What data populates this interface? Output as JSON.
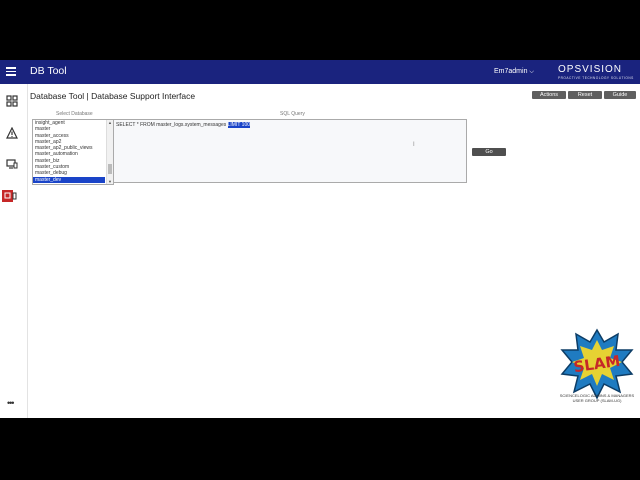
{
  "header": {
    "app_title": "DB Tool",
    "user": "Em7admin",
    "logo_main": "OPSVISION",
    "logo_sub": "PROACTIVE TECHNOLOGY SOLUTIONS"
  },
  "page": {
    "title": "Database Tool | Database Support Interface",
    "buttons": {
      "actions": "Actions",
      "reset": "Reset",
      "guide": "Guide"
    },
    "go": "Go"
  },
  "labels": {
    "select_db": "Select Database",
    "sql_query": "SQL Query"
  },
  "databases": [
    "insight_agent",
    "master",
    "master_access",
    "master_ap2",
    "master_ap2_public_views",
    "master_automation",
    "master_biz",
    "master_custom",
    "master_debug",
    "master_dev"
  ],
  "sql": {
    "text": "SELECT * FROM master_logs.system_messages ",
    "highlight": "LIMIT 100"
  },
  "footer_logo": {
    "line1": "SCIENCELOGIC ADMINS & MANAGERS",
    "line2": "USER GROUP (SLAM-UG)"
  }
}
